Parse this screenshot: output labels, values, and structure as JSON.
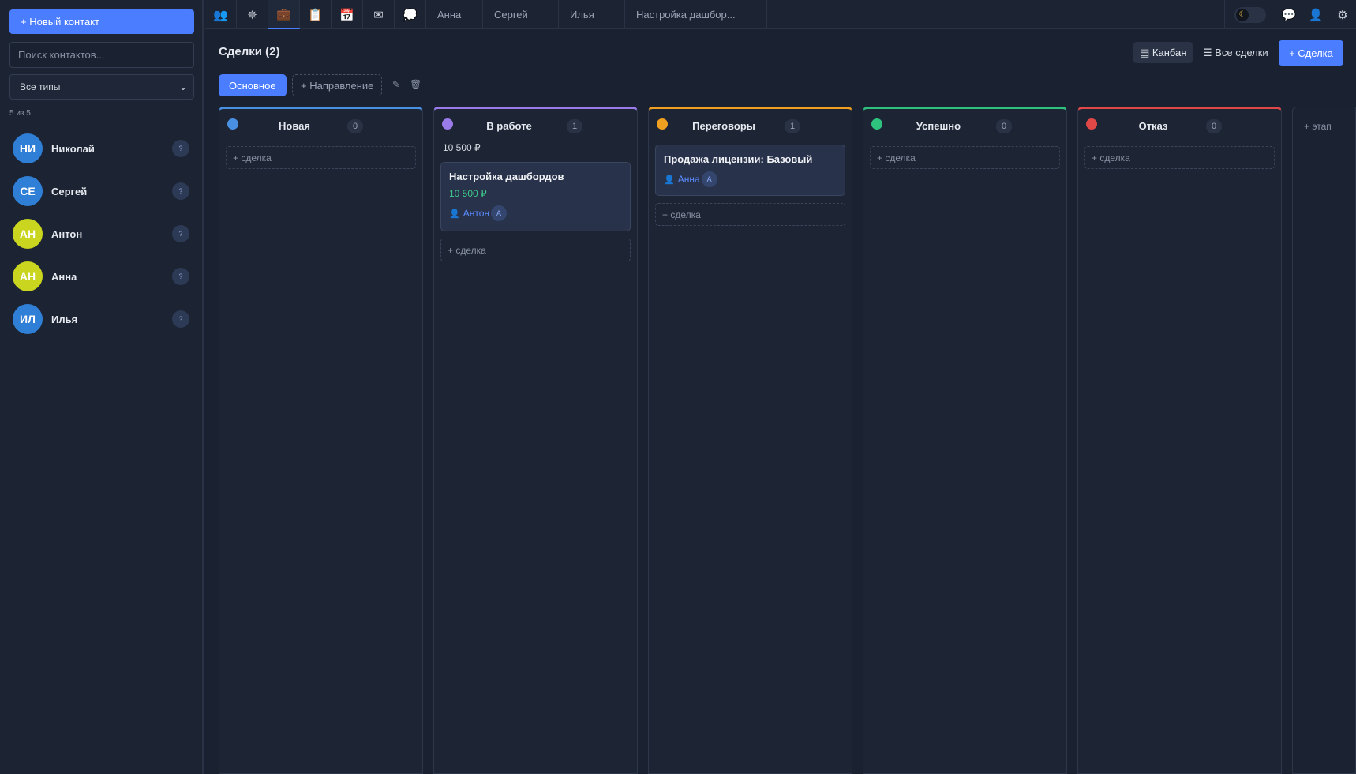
{
  "sidebar": {
    "new_contact_label": "+ Новый контакт",
    "search_placeholder": "Поиск контактов...",
    "type_filter": "Все типы",
    "count_text": "5 из 5",
    "contacts": [
      {
        "initials": "НИ",
        "name": "Николай",
        "badge": "?",
        "color": "#2f7fd6"
      },
      {
        "initials": "СЕ",
        "name": "Сергей",
        "badge": "?",
        "color": "#2f7fd6"
      },
      {
        "initials": "АН",
        "name": "Антон",
        "badge": "?",
        "color": "#c9d51f"
      },
      {
        "initials": "АН",
        "name": "Анна",
        "badge": "?",
        "color": "#c9d51f"
      },
      {
        "initials": "ИЛ",
        "name": "Илья",
        "badge": "?",
        "color": "#2f7fd6"
      }
    ]
  },
  "topbar": {
    "icon_tabs": [
      "contacts-icon",
      "network-icon",
      "briefcase-icon",
      "clipboard-icon",
      "calendar-icon",
      "mail-icon",
      "chat-bubble-icon"
    ],
    "text_tabs": [
      "Анна",
      "Сергей",
      "Илья",
      "Настройка дашбор..."
    ],
    "theme_icon": "moon-icon"
  },
  "main": {
    "title": "Сделки (2)",
    "view_kanban": "▤ Канбан",
    "view_all": "☰ Все сделки",
    "add_deal": "+ Сделка",
    "pipeline_main": "Основное",
    "pipeline_add": "+ Направление",
    "add_stage": "+ этап"
  },
  "columns": [
    {
      "title": "Новая",
      "count": "0",
      "color": "#4a90e2",
      "sum": "",
      "add_label": "+ сделка"
    },
    {
      "title": "В работе",
      "count": "1",
      "color": "#9b7bea",
      "sum": "10 500 ₽",
      "add_label": "+ сделка",
      "card": {
        "title": "Настройка дашбордов",
        "amount": "10 500 ₽",
        "owner": "Антон",
        "owner_initial": "А"
      }
    },
    {
      "title": "Переговоры",
      "count": "1",
      "color": "#f0a020",
      "sum": "",
      "add_label": "+ сделка",
      "card": {
        "title": "Продажа лицензии: Базовый",
        "owner": "Анна",
        "owner_initial": "А"
      }
    },
    {
      "title": "Успешно",
      "count": "0",
      "color": "#2ec27e",
      "sum": "",
      "add_label": "+ сделка"
    },
    {
      "title": "Отказ",
      "count": "0",
      "color": "#e04848",
      "sum": "",
      "add_label": "+ сделка"
    }
  ]
}
